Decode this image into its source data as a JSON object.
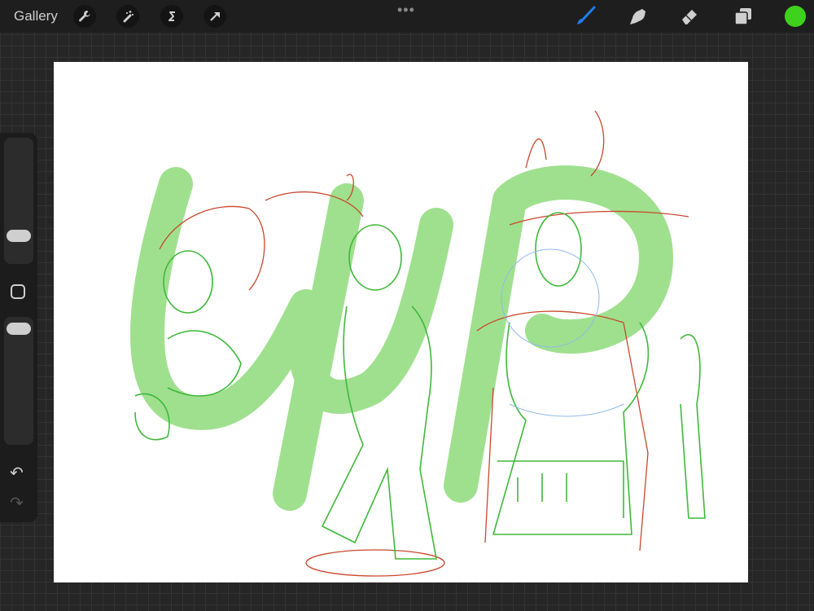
{
  "topbar": {
    "gallery_label": "Gallery",
    "more_label": "•••",
    "tools_left": [
      "wrench-icon",
      "magic-wand-icon",
      "selection-s-icon",
      "transform-arrow-icon"
    ],
    "tools_right": [
      "brush-icon",
      "smudge-icon",
      "eraser-icon",
      "layers-icon"
    ],
    "active_tool": "brush",
    "current_color": "#3fd21c",
    "accent_color": "#1e7cf2"
  },
  "sidebar": {
    "undo_label": "↶",
    "redo_label": "↷"
  },
  "canvas": {
    "stroke_green": "#3fb83a",
    "wip_fill": "#9fe08f",
    "stroke_red": "#c9482c",
    "stroke_blue": "#8fb8e8"
  }
}
